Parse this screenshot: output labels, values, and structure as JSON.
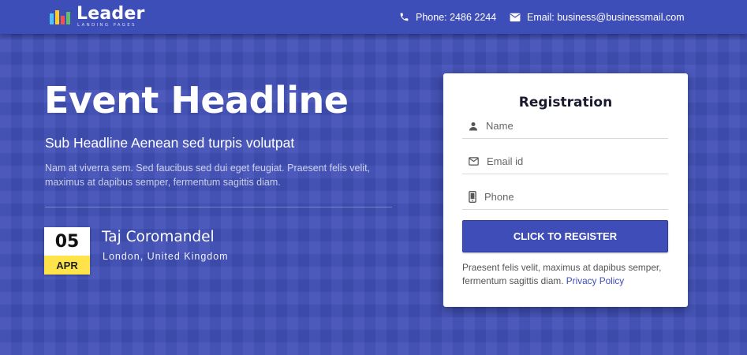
{
  "brand": {
    "name": "Leader",
    "tagline": "LANDING PAGES",
    "logo_colors": [
      "#4fc3f7",
      "#ffca28",
      "#ef5350",
      "#66bb6a"
    ]
  },
  "header": {
    "phone_label": "Phone: 2486 2244",
    "email_label": "Email: business@businessmail.com",
    "phone_icon": "phone-icon",
    "email_icon": "envelope-icon"
  },
  "hero": {
    "title": "Event Headline",
    "subtitle": "Sub Headline Aenean sed turpis volutpat",
    "body": "Nam at viverra sem. Sed faucibus sed dui eget feugiat. Praesent felis velit, maximus at dapibus semper, fermentum sagittis diam."
  },
  "event": {
    "day": "05",
    "month": "APR",
    "venue": "Taj Coromandel",
    "location": "London, United Kingdom"
  },
  "form": {
    "title": "Registration",
    "fields": {
      "name": {
        "placeholder": "Name",
        "icon": "person-icon"
      },
      "email": {
        "placeholder": "Email id",
        "icon": "email-icon"
      },
      "phone": {
        "placeholder": "Phone",
        "icon": "mobile-phone-icon"
      }
    },
    "submit_label": "CLICK TO REGISTER",
    "note": "Praesent felis velit, maximus at dapibus semper, fermentum sagittis diam.",
    "privacy_link": "Privacy Policy"
  },
  "colors": {
    "primary": "#3e4db8",
    "accent_yellow": "#ffe34a",
    "background": "#4150b8"
  }
}
